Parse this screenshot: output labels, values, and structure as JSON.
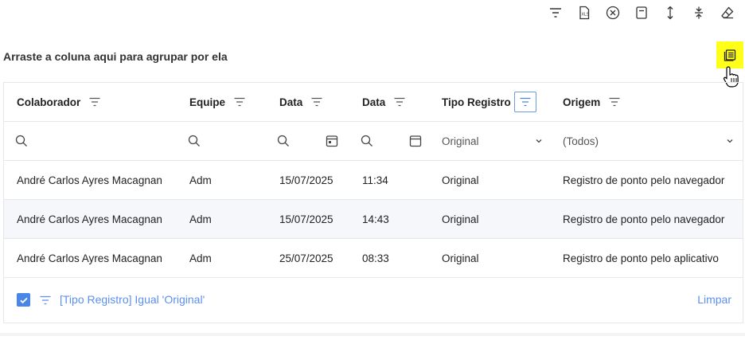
{
  "group_panel": {
    "hint": "Arraste a coluna aqui para agrupar por ela"
  },
  "grid": {
    "columns": [
      {
        "label": "Colaborador"
      },
      {
        "label": "Equipe"
      },
      {
        "label": "Data"
      },
      {
        "label": "Data"
      },
      {
        "label": "Tipo Registro"
      },
      {
        "label": "Origem"
      }
    ],
    "filter_row": {
      "tipo_registro_value": "Original",
      "origem_value": "(Todos)"
    },
    "rows": [
      {
        "colaborador": "André Carlos Ayres Macagnan",
        "equipe": "Adm",
        "data": "15/07/2025",
        "hora": "11:34",
        "tipo": "Original",
        "origem": "Registro de ponto pelo navegador"
      },
      {
        "colaborador": "André Carlos Ayres Macagnan",
        "equipe": "Adm",
        "data": "15/07/2025",
        "hora": "14:43",
        "tipo": "Original",
        "origem": "Registro de ponto pelo navegador"
      },
      {
        "colaborador": "André Carlos Ayres Macagnan",
        "equipe": "Adm",
        "data": "25/07/2025",
        "hora": "08:33",
        "tipo": "Original",
        "origem": "Registro de ponto pelo aplicativo"
      }
    ]
  },
  "filter_panel": {
    "enabled": true,
    "expression": "[Tipo Registro] Igual 'Original'",
    "clear_label": "Limpar"
  },
  "colors": {
    "accent": "#4a86e8",
    "link": "#5b8ff0",
    "highlight": "#ffff1a",
    "active_filter_border": "#6b9ce0"
  }
}
